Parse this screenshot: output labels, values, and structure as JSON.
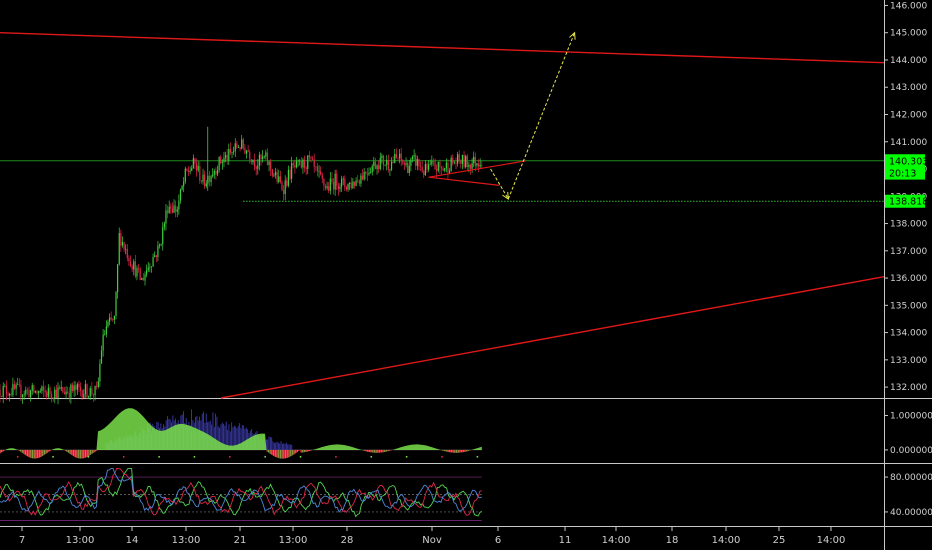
{
  "chart_data": [
    {
      "type": "candlestick",
      "ylim": [
        131.6,
        146.2
      ],
      "y_ticks": [
        "132.000",
        "133.000",
        "134.000",
        "135.000",
        "136.000",
        "137.000",
        "138.000",
        "139.000",
        "140.000",
        "141.000",
        "142.000",
        "143.000",
        "144.000",
        "145.000",
        "146.000"
      ],
      "price_badges": [
        {
          "label": "140.303",
          "value": 140.303,
          "color": "#00ff00"
        },
        {
          "label": "20:13",
          "value": 139.85,
          "color": "#00ff00"
        },
        {
          "label": "138.818",
          "value": 138.818,
          "color": "#00ff00"
        }
      ],
      "horizontal_levels": [
        {
          "value": 140.303,
          "color": "#1f8c1f"
        },
        {
          "value": 138.818,
          "color": "#36c236",
          "dotted": true
        }
      ],
      "trendlines_red": [
        {
          "from": [
            0,
            145.0
          ],
          "to": [
            1,
            143.9
          ]
        },
        {
          "from": [
            0.25,
            131.6
          ],
          "to": [
            1,
            136.05
          ]
        }
      ],
      "candle_path": [
        [
          0.0,
          131.9
        ],
        [
          0.05,
          131.8
        ],
        [
          0.09,
          131.9
        ],
        [
          0.11,
          131.8
        ],
        [
          0.115,
          133.5
        ],
        [
          0.12,
          134.2
        ],
        [
          0.13,
          134.5
        ],
        [
          0.135,
          137.6
        ],
        [
          0.14,
          137.2
        ],
        [
          0.15,
          136.5
        ],
        [
          0.16,
          135.9
        ],
        [
          0.17,
          136.6
        ],
        [
          0.18,
          137.1
        ],
        [
          0.19,
          138.7
        ],
        [
          0.2,
          138.5
        ],
        [
          0.21,
          139.8
        ],
        [
          0.22,
          140.2
        ],
        [
          0.23,
          139.5
        ],
        [
          0.24,
          139.9
        ],
        [
          0.25,
          140.3
        ],
        [
          0.26,
          140.5
        ],
        [
          0.27,
          140.9
        ],
        [
          0.28,
          140.7
        ],
        [
          0.29,
          140.2
        ],
        [
          0.3,
          140.4
        ],
        [
          0.31,
          139.8
        ],
        [
          0.32,
          139.3
        ],
        [
          0.33,
          140.0
        ],
        [
          0.34,
          140.1
        ],
        [
          0.35,
          140.3
        ],
        [
          0.36,
          139.7
        ],
        [
          0.37,
          139.3
        ],
        [
          0.38,
          139.6
        ],
        [
          0.39,
          139.4
        ],
        [
          0.4,
          139.5
        ],
        [
          0.41,
          139.8
        ],
        [
          0.42,
          140.1
        ],
        [
          0.43,
          140.3
        ],
        [
          0.44,
          140.2
        ],
        [
          0.45,
          140.4
        ],
        [
          0.46,
          140.1
        ],
        [
          0.47,
          140.3
        ],
        [
          0.48,
          139.9
        ],
        [
          0.49,
          140.1
        ],
        [
          0.5,
          140.0
        ],
        [
          0.51,
          140.2
        ],
        [
          0.52,
          140.3
        ],
        [
          0.53,
          140.2
        ],
        [
          0.545,
          140.35
        ]
      ],
      "projection_arrows": [
        {
          "points": [
            [
              0.555,
              140.0
            ],
            [
              0.575,
              138.9
            ],
            [
              0.65,
              145.0
            ]
          ],
          "color": "#e8e84a"
        }
      ],
      "wedge_lines": [
        {
          "from": [
            0.485,
            139.7
          ],
          "to": [
            0.595,
            140.3
          ]
        },
        {
          "from": [
            0.485,
            139.7
          ],
          "to": [
            0.565,
            139.4
          ]
        }
      ]
    },
    {
      "type": "area",
      "name": "oscillator",
      "ylim": [
        -0.35,
        1.45
      ],
      "y_ticks": [
        "1.000000",
        "0.000000"
      ],
      "colors": {
        "positive": "#7ae04a",
        "negative": "#d6203a",
        "blue": "#3a3aa8"
      }
    },
    {
      "type": "line",
      "name": "rsi",
      "ylim": [
        25,
        95
      ],
      "y_ticks": [
        "80.000000",
        "40.000000"
      ],
      "levels": [
        80,
        60,
        40,
        30
      ]
    }
  ],
  "x_axis": {
    "ticks": [
      "7",
      "13:00",
      "14",
      "13:00",
      "21",
      "13:00",
      "28",
      "Nov",
      "6",
      "11",
      "14:00",
      "18",
      "14:00",
      "25",
      "14:00"
    ]
  }
}
